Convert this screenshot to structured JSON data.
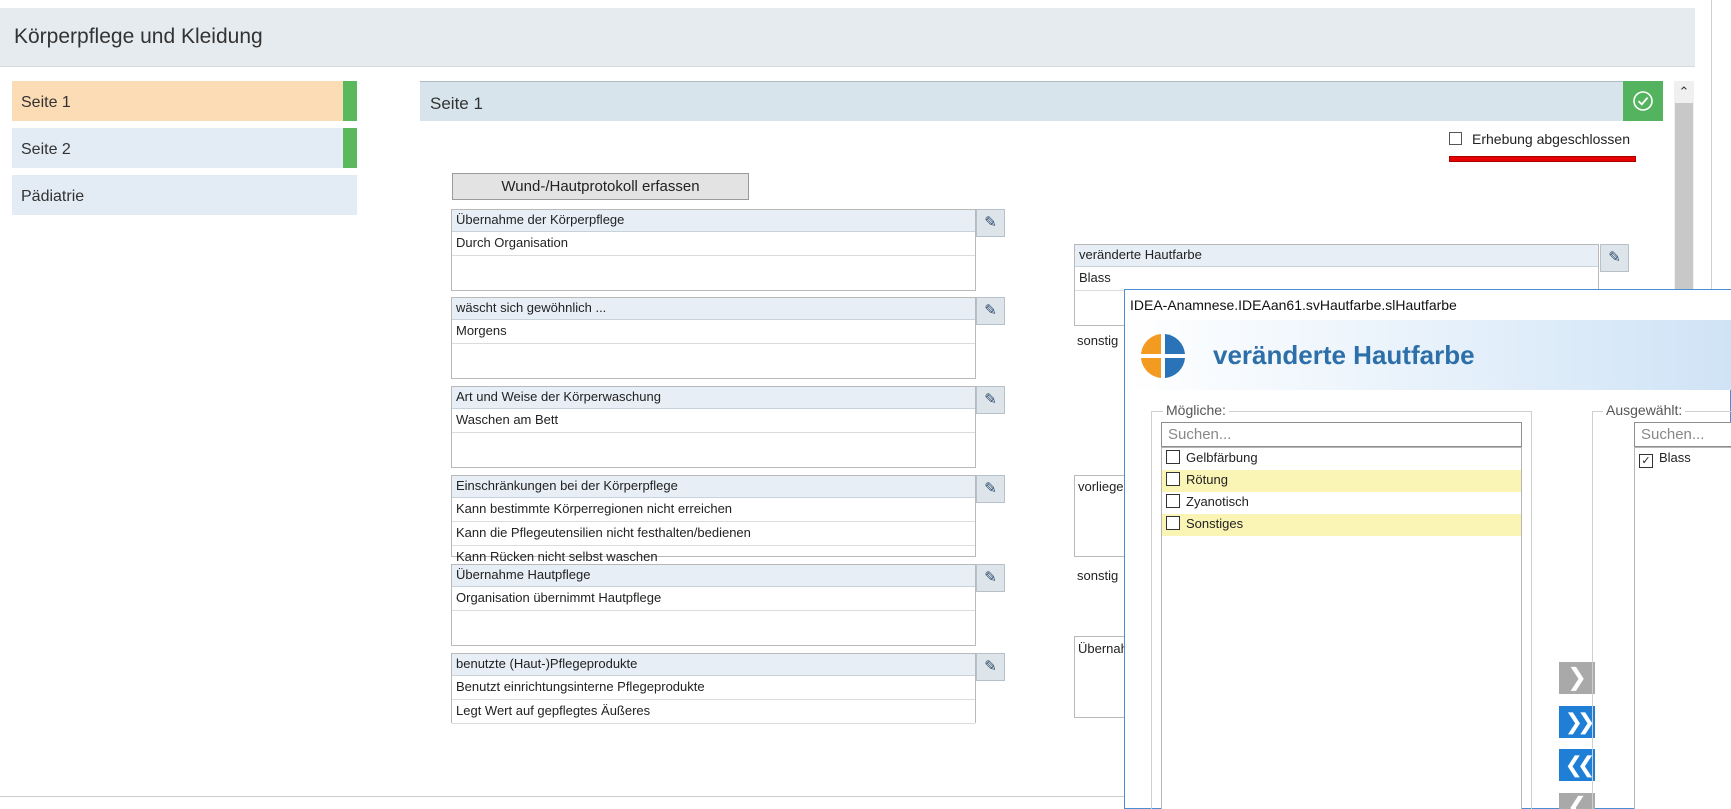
{
  "header": {
    "title": "Körperpflege und Kleidung"
  },
  "nav": {
    "items": [
      {
        "label": "Seite 1"
      },
      {
        "label": "Seite 2"
      },
      {
        "label": "Pädiatrie"
      }
    ],
    "colors": {
      "active": "#fbdcb4",
      "inactive": "#e3ebf4",
      "done_marker": "#5cb85c"
    }
  },
  "page": {
    "title": "Seite 1",
    "check_icon": "check-circle-icon",
    "erhebung_label": "Erhebung abgeschlossen",
    "erhebung_checked": false,
    "wund_button": "Wund-/Hautprotokoll erfassen"
  },
  "fields_left": [
    {
      "title": "Übernahme der Körperpflege",
      "values": [
        "Durch Organisation"
      ]
    },
    {
      "title": "wäscht sich gewöhnlich ...",
      "values": [
        "Morgens"
      ]
    },
    {
      "title": "Art und Weise der Körperwaschung",
      "values": [
        "Waschen am Bett"
      ]
    },
    {
      "title": "Einschränkungen bei der Körperpflege",
      "values": [
        "Kann bestimmte Körperregionen nicht erreichen",
        "Kann die Pflegeutensilien nicht festhalten/bedienen",
        "Kann Rücken nicht selbst waschen"
      ]
    },
    {
      "title": "Übernahme Hautpflege",
      "values": [
        "Organisation übernimmt Hautpflege"
      ]
    },
    {
      "title": "benutzte (Haut-)Pflegeprodukte",
      "values": [
        "Benutzt einrichtungsinterne Pflegeprodukte",
        "Legt Wert auf gepflegtes Äußeres"
      ]
    }
  ],
  "fields_right": {
    "hautfarbe": {
      "title": "veränderte Hautfarbe",
      "values": [
        "Blass"
      ]
    },
    "sonstige_1": "sonstig",
    "vorliegend": "vorliege",
    "sonstige_2": "sonstig",
    "uebernahme": "Übernah"
  },
  "dialog": {
    "window_title": "IDEA-Anamnese.IDEAan61.svHautfarbe.slHautfarbe",
    "heading": "veränderte Hautfarbe",
    "possible": {
      "label": "Mögliche:",
      "search_placeholder": "Suchen...",
      "items": [
        {
          "label": "Gelbfärbung",
          "checked": false,
          "highlight": false
        },
        {
          "label": "Rötung",
          "checked": false,
          "highlight": true
        },
        {
          "label": "Zyanotisch",
          "checked": false,
          "highlight": false
        },
        {
          "label": "Sonstiges",
          "checked": false,
          "highlight": true
        }
      ]
    },
    "selected": {
      "label": "Ausgewählt:",
      "search_placeholder": "Suchen...",
      "items": [
        {
          "label": "Blass",
          "checked": true
        }
      ]
    },
    "buttons": [
      {
        "icon": "chevron-right-icon",
        "glyph": "❯",
        "color": "#a9a9a9"
      },
      {
        "icon": "double-chevron-right-icon",
        "glyph": "❯❯",
        "color": "#1f7fd6"
      },
      {
        "icon": "double-chevron-left-icon",
        "glyph": "❮❮",
        "color": "#1f7fd6"
      },
      {
        "icon": "chevron-left-icon",
        "glyph": "❮",
        "color": "#a9a9a9"
      }
    ]
  }
}
